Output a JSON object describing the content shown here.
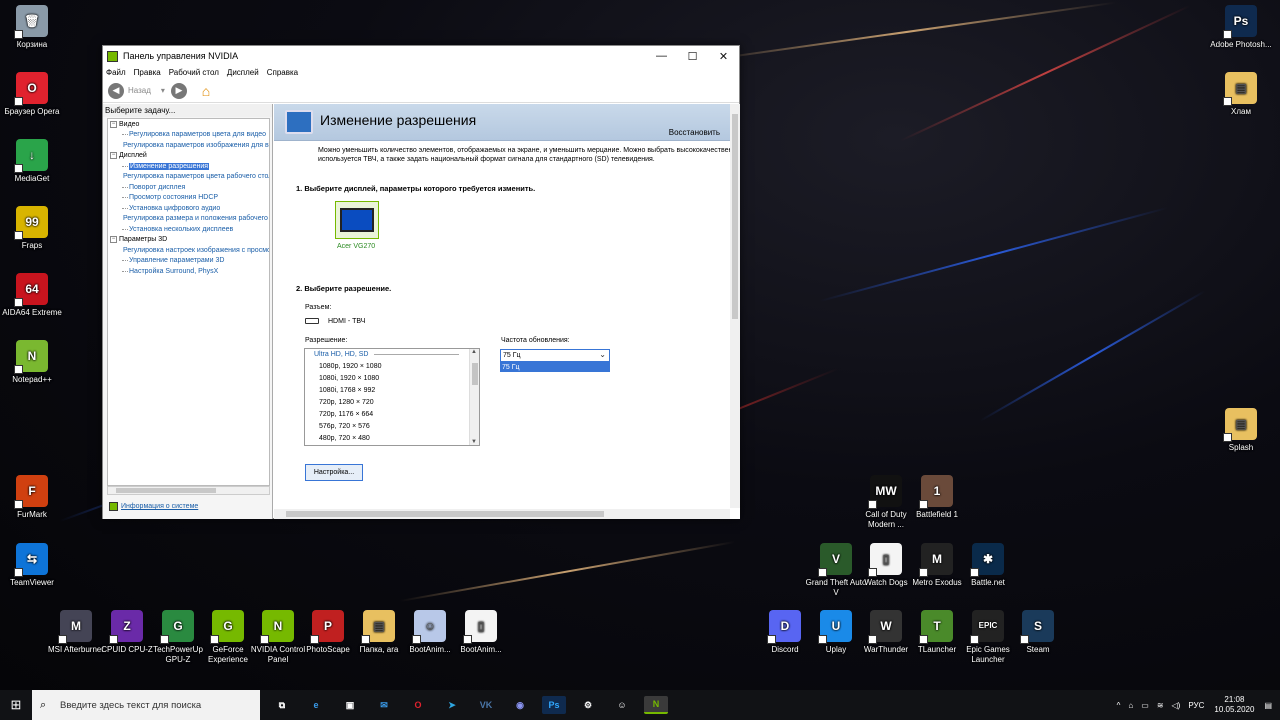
{
  "window": {
    "title": "Панель управления NVIDIA",
    "menu": [
      "Файл",
      "Правка",
      "Рабочий стол",
      "Дисплей",
      "Справка"
    ],
    "toolbar": {
      "back_label": "Назад"
    }
  },
  "left_panel": {
    "task_header": "Выберите задачу...",
    "tree": [
      {
        "label": "Видео",
        "level": 0,
        "toggle": "⊟"
      },
      {
        "label": "Регулировка параметров цвета для видео",
        "level": 1
      },
      {
        "label": "Регулировка параметров изображения для видео",
        "level": 1
      },
      {
        "label": "Дисплей",
        "level": 0,
        "toggle": "⊟"
      },
      {
        "label": "Изменение разрешения",
        "level": 1,
        "selected": true
      },
      {
        "label": "Регулировка параметров цвета рабочего стола",
        "level": 1
      },
      {
        "label": "Поворот дисплея",
        "level": 1
      },
      {
        "label": "Просмотр состояния HDCP",
        "level": 1
      },
      {
        "label": "Установка цифрового аудио",
        "level": 1
      },
      {
        "label": "Регулировка размера и положения рабочего стола",
        "level": 1
      },
      {
        "label": "Установка нескольких дисплеев",
        "level": 1
      },
      {
        "label": "Параметры 3D",
        "level": 0,
        "toggle": "⊟"
      },
      {
        "label": "Регулировка настроек изображения с просмотром",
        "level": 1
      },
      {
        "label": "Управление параметрами 3D",
        "level": 1
      },
      {
        "label": "Настройка Surround, PhysX",
        "level": 1
      }
    ],
    "system_info": "Информация о системе"
  },
  "content": {
    "title": "Изменение разрешения",
    "restore": "Восстановить",
    "description_line1": "Можно уменьшить количество элементов, отображаемых на экране, и уменьшить мерцание. Можно выбрать высококачественный",
    "description_line2": "используется ТВЧ, а также задать национальный формат сигнала для стандартного (SD) телевидения.",
    "step1": "1. Выберите дисплей, параметры которого требуется изменить.",
    "monitor_name": "Acer VG270",
    "step2": "2. Выберите разрешение.",
    "connector_label": "Разъем:",
    "connector_value": "HDMI - ТВЧ",
    "resolution_label": "Разрешение:",
    "resolution_group": "Ultra HD, HD, SD",
    "resolutions": [
      "1080p, 1920 × 1080",
      "1080i, 1920 × 1080",
      "1080i, 1768 × 992",
      "720p, 1280 × 720",
      "720p, 1176 × 664",
      "576p, 720 × 576",
      "480p, 720 × 480"
    ],
    "refresh_label": "Частота обновления:",
    "refresh_value": "75 Гц",
    "refresh_option": "75 Гц",
    "settings_button": "Настройка..."
  },
  "desktop_icons": [
    {
      "label": "Корзина",
      "color": "#8a9aa8",
      "glyph": "🗑"
    },
    {
      "label": "Браузер Opera",
      "color": "#e0222e",
      "glyph": "O"
    },
    {
      "label": "MediaGet",
      "color": "#2aa44a",
      "glyph": "↓"
    },
    {
      "label": "Fraps",
      "color": "#d8b400",
      "glyph": "99"
    },
    {
      "label": "AIDA64 Extreme",
      "color": "#c8141e",
      "glyph": "64"
    },
    {
      "label": "Notepad++",
      "color": "#7ab830",
      "glyph": "N"
    },
    {
      "label": "FurMark",
      "color": "#d04010",
      "glyph": "F"
    },
    {
      "label": "TeamViewer",
      "color": "#0e74d8",
      "glyph": "⇆"
    },
    {
      "label": "MSI Afterburner",
      "color": "#445",
      "glyph": "M"
    },
    {
      "label": "CPUID CPU-Z",
      "color": "#6a2aa8",
      "glyph": "Z"
    },
    {
      "label": "TechPowerUp GPU-Z",
      "color": "#2a8a40",
      "glyph": "G"
    },
    {
      "label": "GeForce Experience",
      "color": "#76b900",
      "glyph": "G"
    },
    {
      "label": "NVIDIA Control Panel",
      "color": "#76b900",
      "glyph": "N"
    },
    {
      "label": "PhotoScape",
      "color": "#c02020",
      "glyph": "P"
    },
    {
      "label": "Папка, ara",
      "color": "#e8c060",
      "glyph": "▤"
    },
    {
      "label": "BootAnim...",
      "color": "#b8c8e8",
      "glyph": "☺"
    },
    {
      "label": "BootAnim...",
      "color": "#f4f4f4",
      "glyph": "▯"
    },
    {
      "label": "Adobe Photosh...",
      "color": "#0f2a4e",
      "glyph": "Ps"
    },
    {
      "label": "Хлам",
      "color": "#e8c060",
      "glyph": "▤"
    },
    {
      "label": "Splash",
      "color": "#e8c060",
      "glyph": "▤"
    },
    {
      "label": "Call of Duty Modern ...",
      "color": "#111",
      "glyph": "MW"
    },
    {
      "label": "Battlefield 1",
      "color": "#6a4a3a",
      "glyph": "1"
    },
    {
      "label": "Grand Theft Auto V",
      "color": "#2a5a2a",
      "glyph": "V"
    },
    {
      "label": "Watch Dogs",
      "color": "#f4f4f4",
      "glyph": "▯"
    },
    {
      "label": "Metro Exodus",
      "color": "#222",
      "glyph": "M"
    },
    {
      "label": "Battle.net",
      "color": "#0a2a4a",
      "glyph": "✱"
    },
    {
      "label": "Discord",
      "color": "#5865f2",
      "glyph": "D"
    },
    {
      "label": "Uplay",
      "color": "#1a8ae8",
      "glyph": "U"
    },
    {
      "label": "WarThunder",
      "color": "#333",
      "glyph": "W"
    },
    {
      "label": "TLauncher",
      "color": "#4a8a2a",
      "glyph": "T"
    },
    {
      "label": "Epic Games Launcher",
      "color": "#222",
      "glyph": "EPIC"
    },
    {
      "label": "Steam",
      "color": "#1a3a5a",
      "glyph": "S"
    }
  ],
  "taskbar": {
    "search_placeholder": "Введите здесь текст для поиска",
    "language": "РУС",
    "time": "21:08",
    "date": "10.05.2020"
  }
}
